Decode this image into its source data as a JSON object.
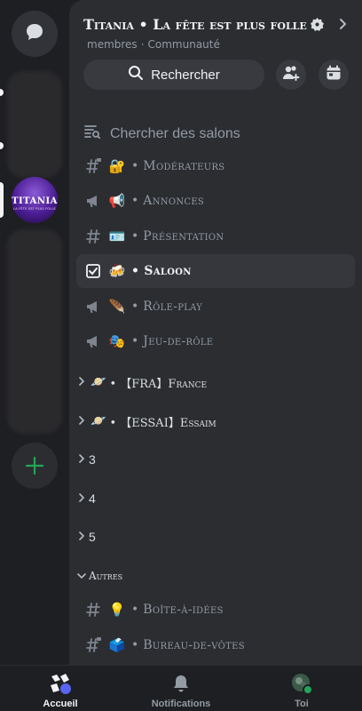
{
  "server": {
    "name": "Titania • La fête est plus folle",
    "members_label": "membres",
    "community_label": "Communauté",
    "icon_title": "TITANIA",
    "icon_subtitle": "LA FÊTE EST PLUS FOLLE"
  },
  "toolbar": {
    "search_label": "Rechercher",
    "invite_icon": "add-member-icon",
    "events_icon": "calendar-icon"
  },
  "channel_search": {
    "label": "Chercher des salons"
  },
  "channels": [
    {
      "type": "text-locked",
      "emoji": "🔐",
      "name": "• Modérateurs"
    },
    {
      "type": "announcement",
      "emoji": "📢",
      "name": "• Annonces"
    },
    {
      "type": "text",
      "emoji": "🪪",
      "name": "• Présentation"
    },
    {
      "type": "checklist",
      "emoji": "🍻",
      "name": "• Saloon",
      "selected": true
    },
    {
      "type": "announcement",
      "emoji": "🪶",
      "name": "• Rôle-play"
    },
    {
      "type": "announcement",
      "emoji": "🎭",
      "name": "• Jeu-de-rôle"
    }
  ],
  "categories": [
    {
      "emoji": "🪐",
      "name": "• 【FRA】France"
    },
    {
      "emoji": "🪐",
      "name": "• 【ESSAI】Essaim"
    },
    {
      "emoji": "",
      "name": "3"
    },
    {
      "emoji": "",
      "name": "4"
    },
    {
      "emoji": "",
      "name": "5"
    },
    {
      "emoji": "",
      "name": "Autres"
    }
  ],
  "other_channels": [
    {
      "type": "text",
      "emoji": "💡",
      "name": "• Boîte-à-idées"
    },
    {
      "type": "text-locked",
      "emoji": "🗳️",
      "name": "• Bureau-de-vôtes"
    }
  ],
  "bottom_nav": {
    "home_label": "Accueil",
    "notifications_label": "Notifications",
    "you_label": "Toi"
  },
  "colors": {
    "background": "#1e1f22",
    "panel": "#2b2d31",
    "accent_green": "#23a559",
    "blurple": "#5865f2"
  }
}
